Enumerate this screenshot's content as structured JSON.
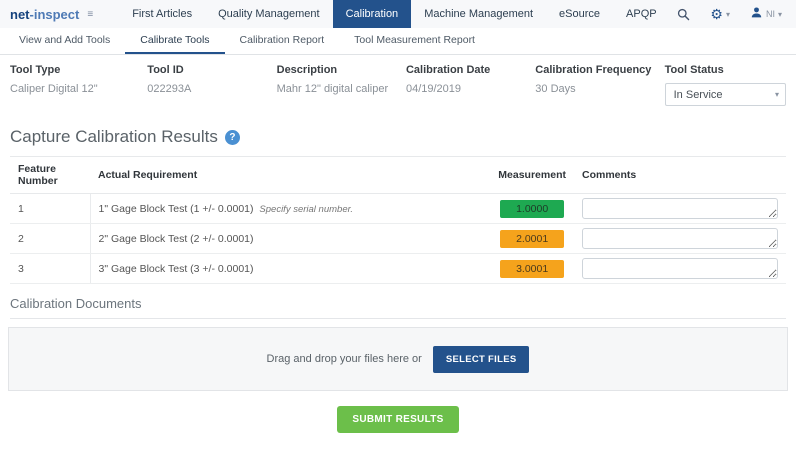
{
  "brand": {
    "bold": "net",
    "light": "-inspect"
  },
  "navbar": {
    "menu": [
      {
        "label": "First Articles",
        "active": false
      },
      {
        "label": "Quality Management",
        "active": false
      },
      {
        "label": "Calibration",
        "active": true
      },
      {
        "label": "Machine Management",
        "active": false
      },
      {
        "label": "eSource",
        "active": false
      },
      {
        "label": "APQP",
        "active": false
      }
    ],
    "user_initials": "NI",
    "icons": {
      "menu": "hamburger",
      "search": "magnifier",
      "settings": "gear",
      "user": "person",
      "caret": "chevron-down"
    }
  },
  "tabs": [
    {
      "label": "View and Add Tools",
      "active": false
    },
    {
      "label": "Calibrate Tools",
      "active": true
    },
    {
      "label": "Calibration Report",
      "active": false
    },
    {
      "label": "Tool Measurement Report",
      "active": false
    }
  ],
  "tool_info": {
    "fields": [
      {
        "label": "Tool Type",
        "value": "Caliper Digital 12\""
      },
      {
        "label": "Tool ID",
        "value": "022293A"
      },
      {
        "label": "Description",
        "value": "Mahr 12\" digital caliper"
      },
      {
        "label": "Calibration Date",
        "value": "04/19/2019"
      },
      {
        "label": "Calibration Frequency",
        "value": "30 Days"
      }
    ],
    "status": {
      "label": "Tool Status",
      "value": "In Service"
    }
  },
  "capture": {
    "title": "Capture Calibration Results",
    "help_icon": "question-mark",
    "columns": [
      "Feature Number",
      "Actual Requirement",
      "Measurement",
      "Comments"
    ],
    "rows": [
      {
        "feature": "1",
        "requirement": "1\" Gage Block Test (1 +/- 0.0001)",
        "note": "Specify serial number.",
        "measurement": "1.0000",
        "measurement_color": "#1ea951",
        "comment": ""
      },
      {
        "feature": "2",
        "requirement": "2\" Gage Block Test (2 +/- 0.0001)",
        "note": "",
        "measurement": "2.0001",
        "measurement_color": "#f5a31c",
        "comment": ""
      },
      {
        "feature": "3",
        "requirement": "3\" Gage Block Test (3 +/- 0.0001)",
        "note": "",
        "measurement": "3.0001",
        "measurement_color": "#f5a31c",
        "comment": ""
      }
    ]
  },
  "documents": {
    "title": "Calibration Documents",
    "drop_text": "Drag and drop your files here or",
    "select_button": "SELECT FILES"
  },
  "submit_button": "SUBMIT RESULTS",
  "colors": {
    "accent_blue": "#23528c",
    "pass_green": "#1ea951",
    "warn_orange": "#f5a31c",
    "submit_green": "#6cbf4a",
    "help_blue": "#4a90d2"
  }
}
